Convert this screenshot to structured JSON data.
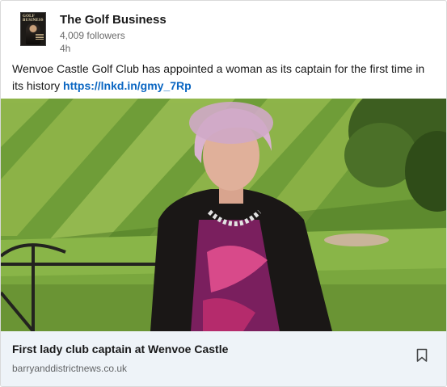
{
  "post": {
    "author": {
      "name": "The Golf Business",
      "followers": "4,009 followers",
      "time": "4h",
      "avatar_lettering": "GOLF BUSINESS"
    },
    "commentary": {
      "text": "Wenvoe Castle Golf Club has appointed a woman as its captain for the first time in its history ",
      "link": "https://lnkd.in/gmy_7Rp"
    },
    "image_icon": "photo-golf-course-captain",
    "article": {
      "title": "First lady club captain at Wenvoe Castle",
      "source": "barryanddistrictnews.co.uk",
      "save_icon": "bookmark-icon"
    }
  },
  "colors": {
    "link": "#0a66c2",
    "footer_bg": "#eef3f8",
    "grass_light": "#9cbf4a",
    "grass_dark": "#5c8a2e"
  }
}
